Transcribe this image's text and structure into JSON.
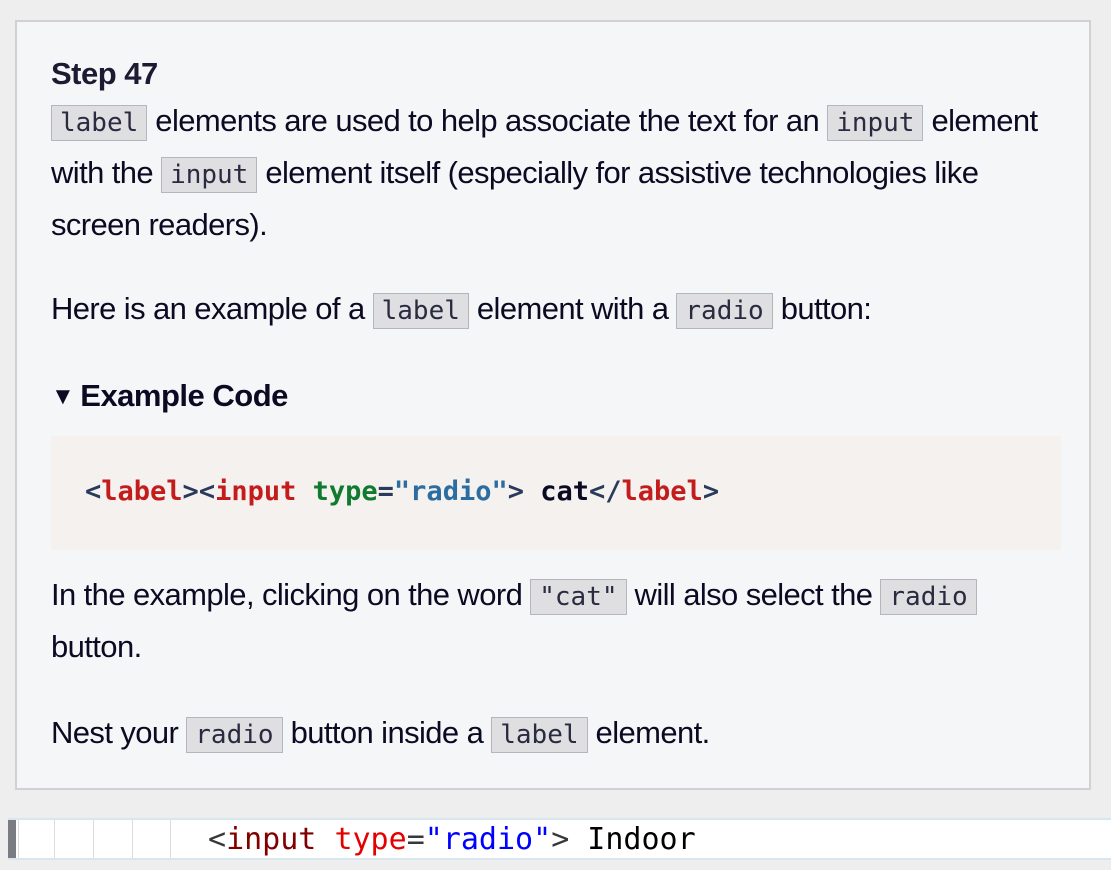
{
  "step": {
    "title": "Step 47"
  },
  "paragraph1": {
    "code_label": "label",
    "text_a": "elements are used to help associate the text for an",
    "code_input_1": "input",
    "text_b": "element with the",
    "code_input_2": "input",
    "text_c": "element itself (especially for assistive technologies like screen readers)."
  },
  "paragraph2": {
    "text_a": "Here is an example of a",
    "code_label": "label",
    "text_b": "element with a",
    "code_radio": "radio",
    "text_c": "button:"
  },
  "example": {
    "summary": "Example Code",
    "code": {
      "open_label_lt": "<",
      "label_tag": "label",
      "open_label_gt": ">",
      "input_lt": "<",
      "input_tag": "input",
      "space": " ",
      "attr": "type",
      "eq": "=",
      "value": "\"radio\"",
      "input_gt": ">",
      "text": " cat",
      "close_lt": "</",
      "close_tag": "label",
      "close_gt": ">"
    }
  },
  "paragraph3": {
    "text_a": "In the example, clicking on the word",
    "code_cat": "\"cat\"",
    "text_b": "will also select the",
    "code_radio": "radio",
    "text_c": "button."
  },
  "paragraph4": {
    "text_a": "Nest your",
    "code_radio": "radio",
    "text_b": "button inside a",
    "code_label": "label",
    "text_c": "element."
  },
  "editor": {
    "line": {
      "lt": "<",
      "tag": "input",
      "space": " ",
      "attr": "type",
      "eq": "=",
      "value": "\"radio\"",
      "gt": ">",
      "text": " Indoor"
    }
  },
  "colors": {
    "panel_bg": "#f5f6f7",
    "code_bg": "#f4f1ef",
    "inline_code_bg": "#dfdfe2",
    "tag_red": "#c31c1c",
    "attr_green": "#117a2e",
    "value_blue": "#2b6da0"
  },
  "icons": {
    "summary_toggle": "triangle-down-icon"
  }
}
